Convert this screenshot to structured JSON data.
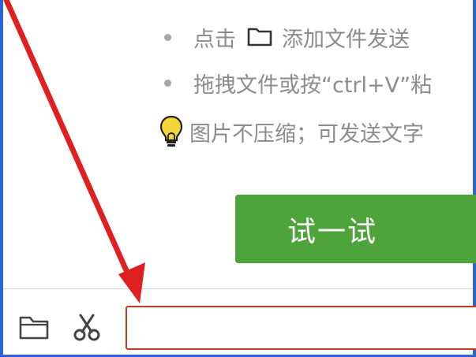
{
  "hints": {
    "add_prefix": "点击",
    "add_suffix": "添加文件发送",
    "drag_text": "拖拽文件或按“ctrl+V”粘"
  },
  "tip": {
    "text": "图片不压缩；可发送文字"
  },
  "try_button": {
    "label": "试一试"
  },
  "toolbar": {
    "folder_icon": "folder-icon",
    "cut_icon": "scissors-icon"
  },
  "message_input": {
    "value": "",
    "placeholder": ""
  },
  "colors": {
    "accent_green": "#4ea33b",
    "annotation_red": "#e02020",
    "frame_blue": "#2b63d9",
    "hint_gray": "#8c8c8c"
  }
}
